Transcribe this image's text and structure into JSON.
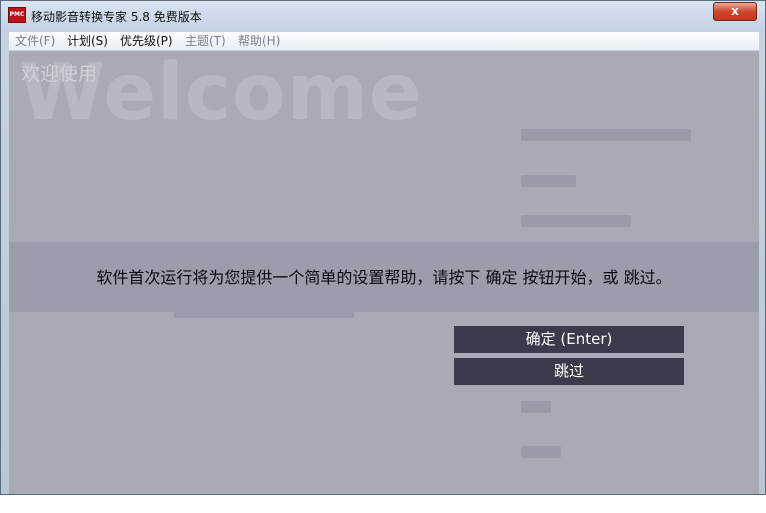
{
  "window": {
    "icon_label": "PMC",
    "title": "移动影音转换专家 5.8 免费版本",
    "close_glyph": "x"
  },
  "menu": [
    {
      "label": "文件(F)",
      "enabled": false
    },
    {
      "label": "计划(S)",
      "enabled": true
    },
    {
      "label": "优先级(P)",
      "enabled": true
    },
    {
      "label": "主题(T)",
      "enabled": false
    },
    {
      "label": "帮助(H)",
      "enabled": false
    }
  ],
  "background": {
    "watermark": "Welcome",
    "welcome_title": "欢迎使用"
  },
  "dialog": {
    "message": "软件首次运行将为您提供一个简单的设置帮助，请按下 确定 按钮开始，或 跳过。",
    "ok_label": "确定 (Enter)",
    "skip_label": "跳过"
  }
}
